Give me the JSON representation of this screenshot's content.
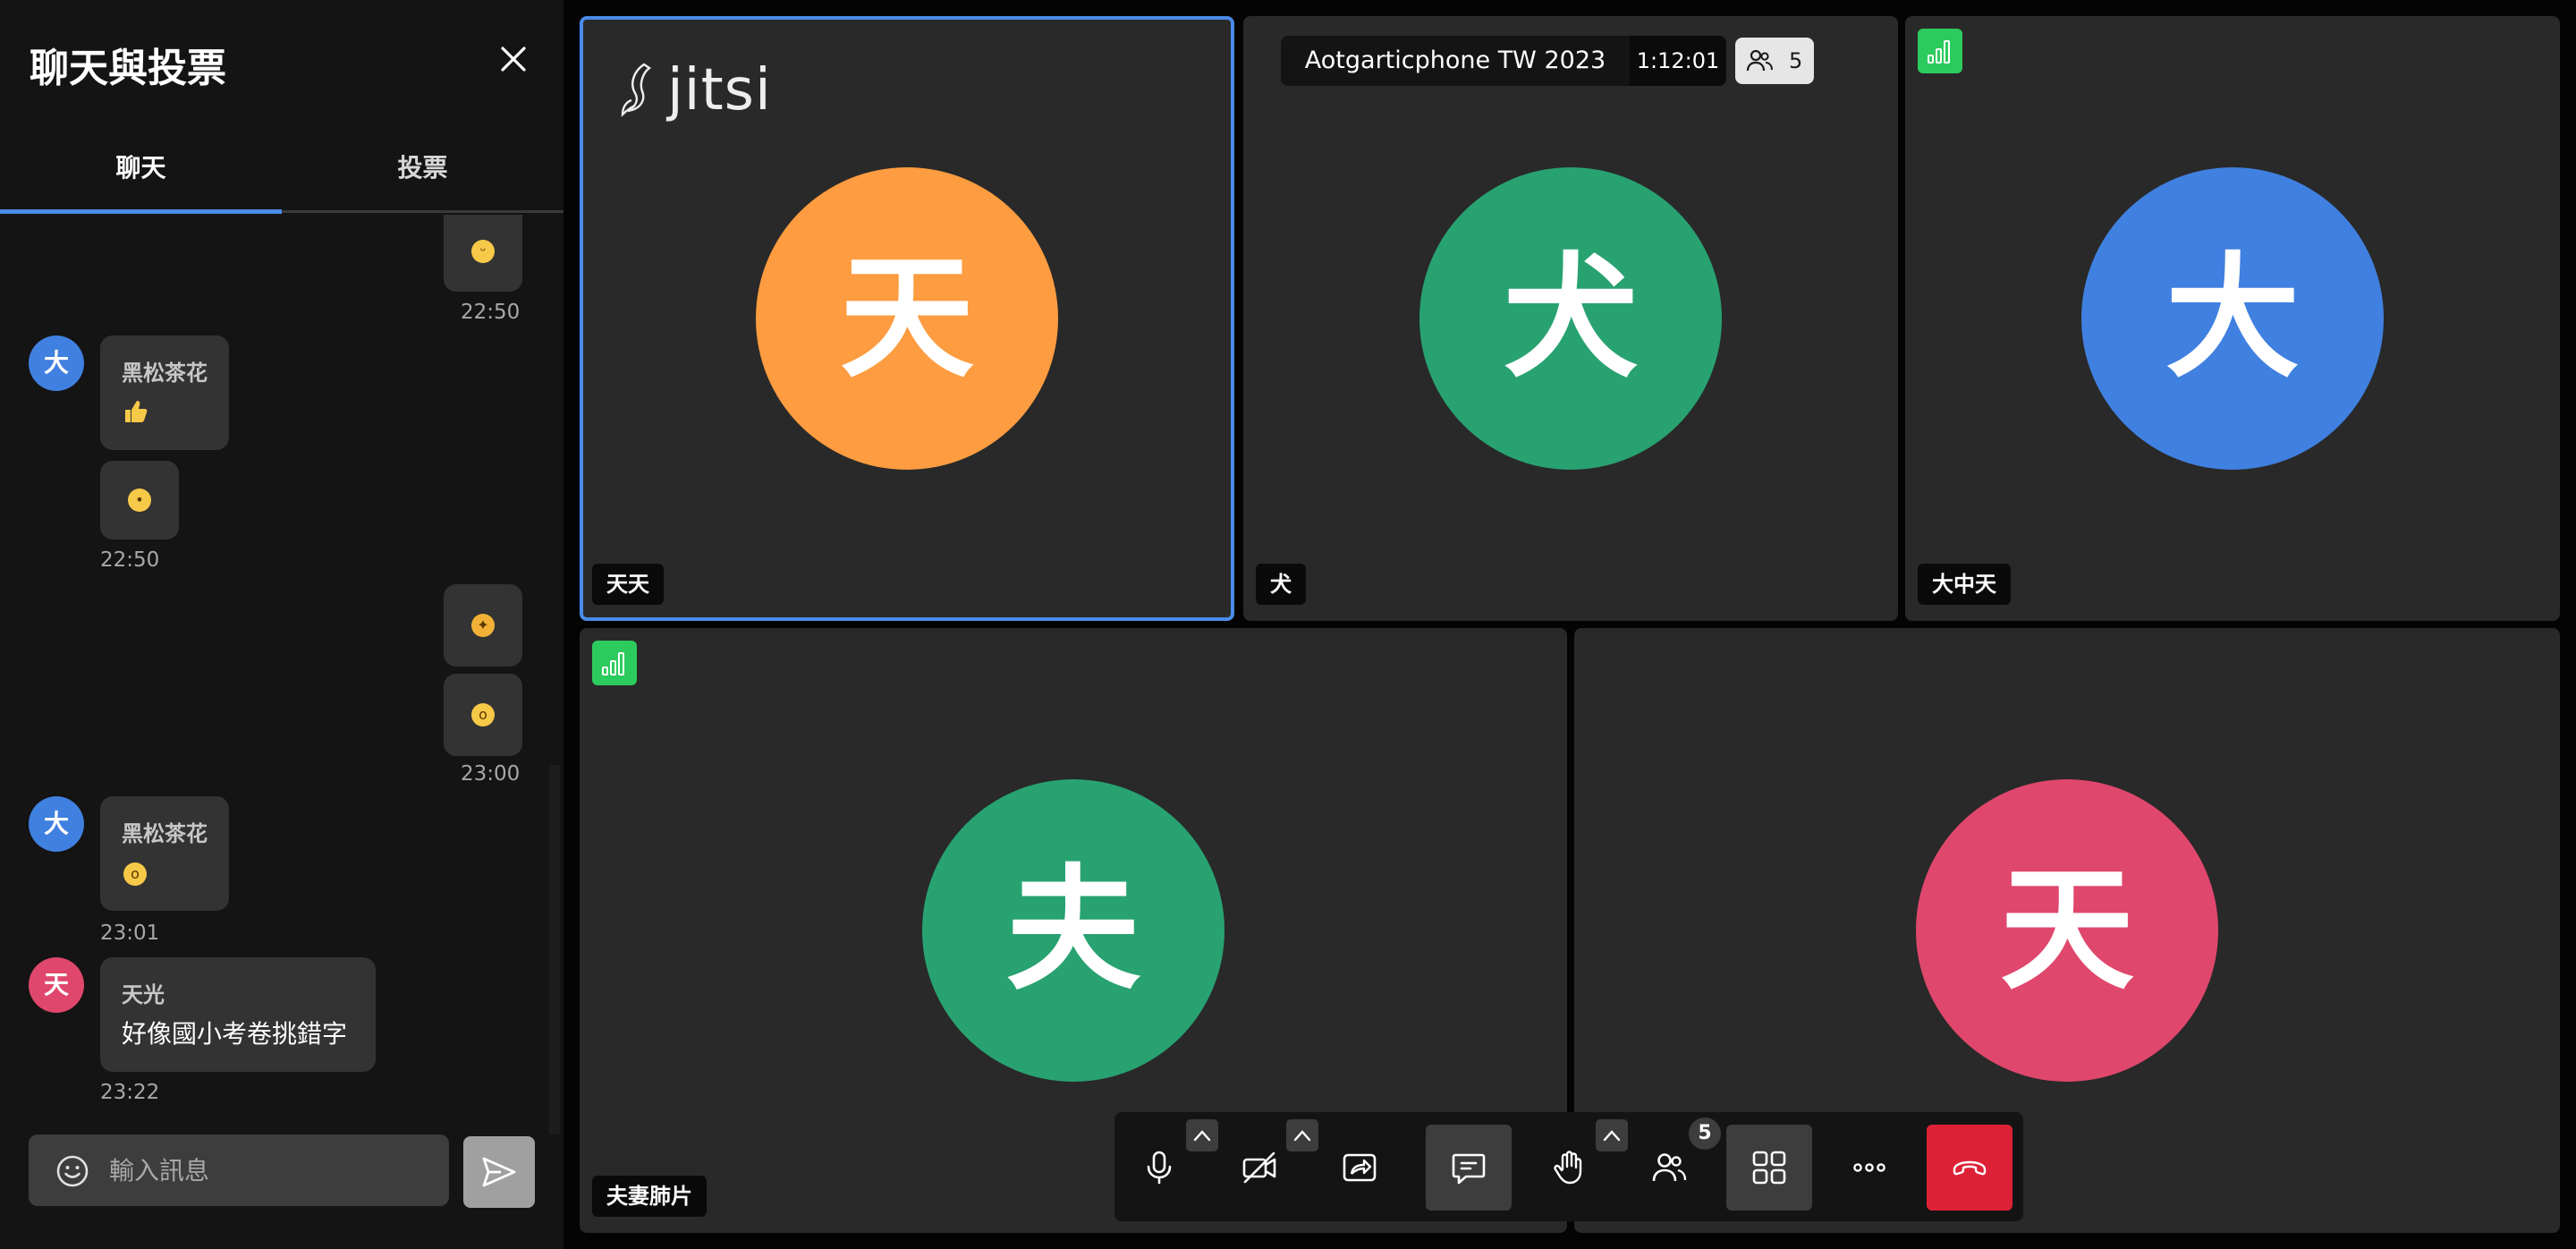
{
  "sidebar": {
    "title": "聊天與投票",
    "tabs": [
      {
        "label": "聊天",
        "active": true
      },
      {
        "label": "投票",
        "active": false
      }
    ],
    "messages": {
      "m1_time": "22:50",
      "g1": {
        "avatar": "大",
        "sender": "黑松茶花",
        "time": "22:50"
      },
      "g2_time": "23:00",
      "g3": {
        "avatar": "大",
        "sender": "黑松茶花",
        "time": "23:01"
      },
      "g4": {
        "avatar": "天",
        "sender": "天光",
        "text": "好像國小考卷挑錯字",
        "time": "23:22"
      }
    },
    "composer": {
      "placeholder": "輸入訊息"
    }
  },
  "meeting": {
    "title": "Aotgarticphone TW 2023",
    "elapsed": "1:12:01",
    "participants": "5",
    "brand": "jitsi"
  },
  "tiles": [
    {
      "name": "天天",
      "avatar": "天",
      "color": "#fd9c40"
    },
    {
      "name": "犬",
      "avatar": "犬",
      "color": "#28a271"
    },
    {
      "name": "大中天",
      "avatar": "大",
      "color": "#4080e0"
    },
    {
      "name": "夫妻肺片",
      "avatar": "夫",
      "color": "#28a271"
    },
    {
      "name": "",
      "avatar": "天",
      "color": "#e0476c"
    }
  ],
  "toolbar": {
    "participants_badge": "5"
  },
  "colors": {
    "accent": "#4a8be8",
    "hangup": "#dd2136",
    "signal": "#2ccb5d"
  }
}
